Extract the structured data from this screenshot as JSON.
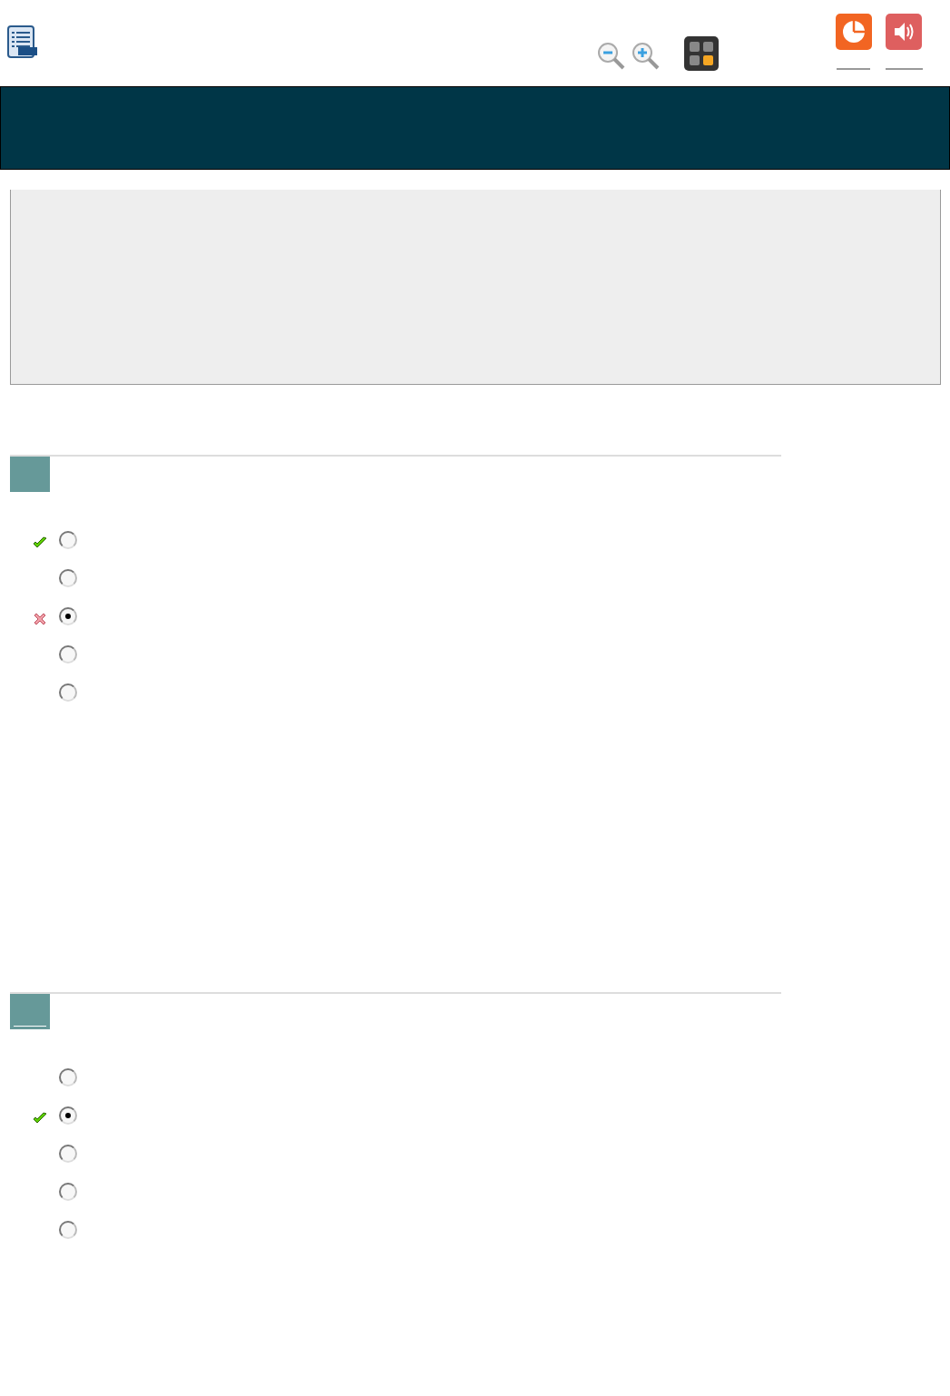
{
  "questions": [
    {
      "badge_underlined": false,
      "options": [
        {
          "selected": false,
          "kind": "correct"
        },
        {
          "selected": false,
          "kind": "plain"
        },
        {
          "selected": true,
          "kind": "wrong"
        },
        {
          "selected": false,
          "kind": "plain"
        },
        {
          "selected": false,
          "kind": "plain"
        }
      ]
    },
    {
      "badge_underlined": true,
      "options": [
        {
          "selected": false,
          "kind": "plain"
        },
        {
          "selected": true,
          "kind": "correct"
        },
        {
          "selected": false,
          "kind": "plain"
        },
        {
          "selected": false,
          "kind": "plain"
        },
        {
          "selected": false,
          "kind": "plain"
        }
      ]
    }
  ]
}
